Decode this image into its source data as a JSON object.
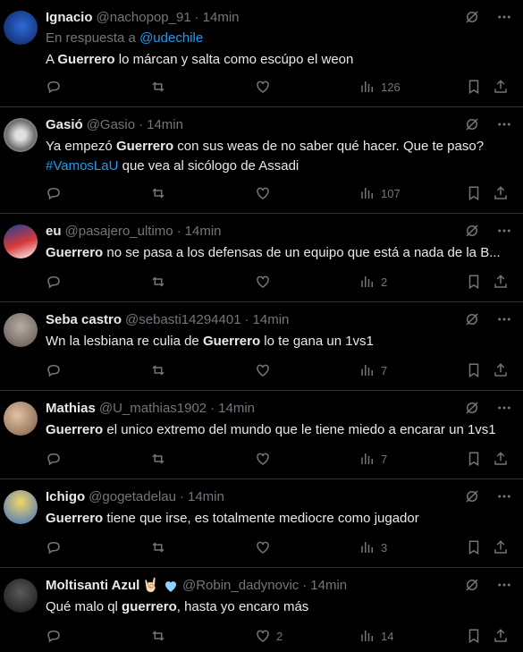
{
  "tweets": [
    {
      "name": "Ignacio",
      "handle": "@nachopop_91",
      "time": "14min",
      "reply_prefix": "En respuesta a",
      "reply_to": "@udechile",
      "text_pre": "A ",
      "text_bold": "Guerrero",
      "text_post": " lo márcan y salta como escúpo el weon",
      "likes": "",
      "views": "126",
      "avatar_color": "#1d3f9c"
    },
    {
      "name": "Gasió",
      "handle": "@Gasio",
      "time": "14min",
      "text_pre": "Ya empezó ",
      "text_bold": "Guerrero",
      "text_post": " con sus weas de no saber qué hacer. Que te paso?",
      "hashtag": "#VamosLaU",
      "line2_post": " que vea al sicólogo de Assadi",
      "likes": "",
      "views": "107",
      "avatar_color": "#b9b9b9"
    },
    {
      "name": "eu",
      "handle": "@pasajero_ultimo",
      "time": "14min",
      "text_pre": "",
      "text_bold": "Guerrero",
      "text_post": " no se pasa a los defensas de un equipo que está a nada de la B...",
      "likes": "",
      "views": "2",
      "avatar_color": "#2a4fa8"
    },
    {
      "name": "Seba castro",
      "handle": "@sebasti14294401",
      "time": "14min",
      "text_pre": "Wn la lesbiana re culia de ",
      "text_bold": "Guerrero",
      "text_post": " lo te gana un 1vs1",
      "likes": "",
      "views": "7",
      "avatar_color": "#8a7f78"
    },
    {
      "name": "Mathias",
      "handle": "@U_mathias1902",
      "time": "14min",
      "text_pre": "",
      "text_bold": "Guerrero",
      "text_post": " el unico extremo del mundo que le tiene miedo a encarar un 1vs1",
      "likes": "",
      "views": "7",
      "avatar_color": "#c7a58a"
    },
    {
      "name": "Ichigo",
      "handle": "@gogetadelau",
      "time": "14min",
      "text_pre": "",
      "text_bold": "Guerrero",
      "text_post": " tiene que irse, es totalmente mediocre como jugador",
      "likes": "",
      "views": "3",
      "avatar_color": "#d8b44a"
    },
    {
      "name": "Moltisanti Azul",
      "name_emoji": "🤘🏻",
      "handle": "@Robin_dadynovic",
      "time": "14min",
      "text_pre": "Qué malo ql ",
      "text_bold": "guerrero",
      "text_post": ", hasta yo encaro más",
      "likes": "2",
      "views": "14",
      "avatar_color": "#3b3b3b"
    }
  ],
  "colors": {
    "accent": "#1d9bf0",
    "muted": "#71767b",
    "text": "#e7e9ea",
    "border": "#2f3336"
  },
  "icons": [
    "grok-icon",
    "more-icon",
    "reply-icon",
    "retweet-icon",
    "like-icon",
    "views-icon",
    "bookmark-icon",
    "share-icon"
  ]
}
